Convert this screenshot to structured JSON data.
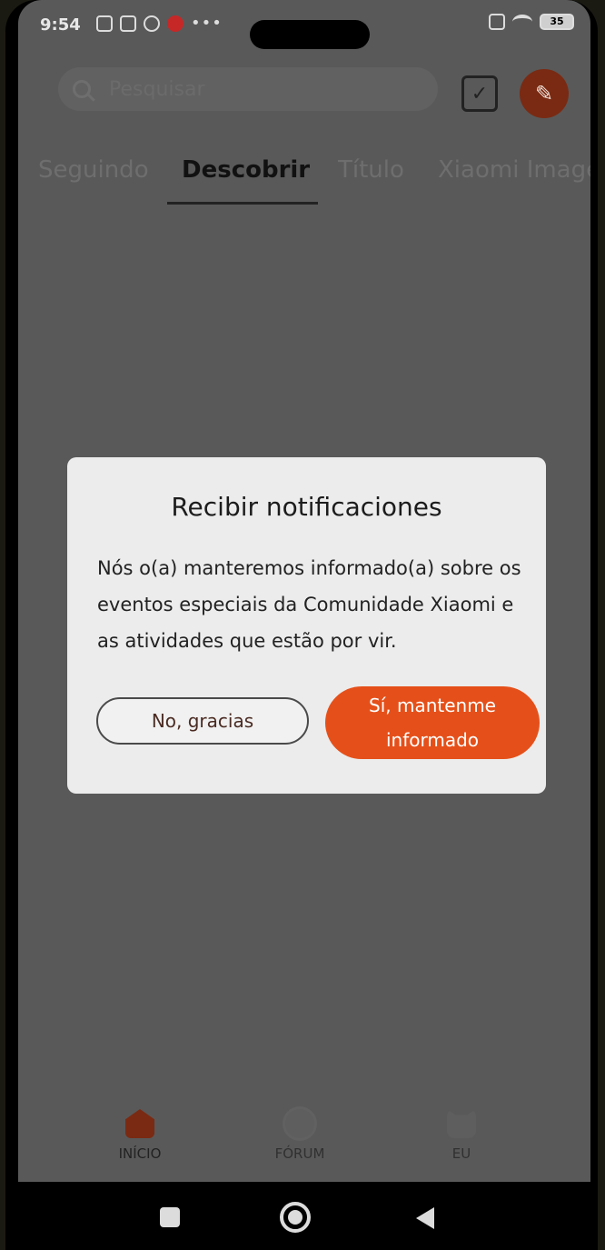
{
  "status_bar": {
    "time": "9:54",
    "battery": "35"
  },
  "header": {
    "search_placeholder": "Pesquisar",
    "calendar_icon": "calendar-check-icon",
    "edit_icon": "pencil-icon"
  },
  "tabs": [
    {
      "label": "Seguindo",
      "active": false
    },
    {
      "label": "Descobrir",
      "active": true
    },
    {
      "label": "Título",
      "active": false
    },
    {
      "label": "Xiaomi Image",
      "active": false
    }
  ],
  "dialog": {
    "title": "Recibir notificaciones",
    "body": "Nós o(a) manteremos informado(a) sobre os eventos especiais da Comunidade Xiaomi e as atividades que estão por vir.",
    "decline_label": "No, gracias",
    "accept_label": "Sí, mantenme informado"
  },
  "bottom_nav": [
    {
      "label": "INÍCIO",
      "icon": "home-icon",
      "active": true
    },
    {
      "label": "FÓRUM",
      "icon": "planet-icon",
      "active": false
    },
    {
      "label": "EU",
      "icon": "profile-icon",
      "active": false
    }
  ],
  "colors": {
    "accent": "#e5501a",
    "overlay_bg": "#595959",
    "dialog_bg": "#ececec"
  }
}
